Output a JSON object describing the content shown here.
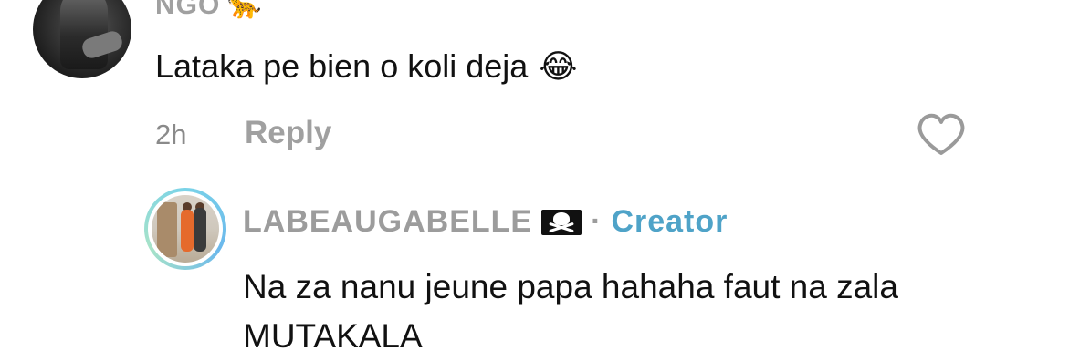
{
  "comment": {
    "username": "NGO",
    "username_emoji": "🐆",
    "text": "Lataka pe bien o koli deja",
    "text_emoji": "😂",
    "time": "2h",
    "reply_label": "Reply",
    "like_icon": "heart-outline-icon"
  },
  "reply": {
    "username": "LABEAUGABELLE",
    "flag_icon": "pirate-flag-icon",
    "separator": "·",
    "badge": "Creator",
    "text": "Na za nanu jeune papa hahaha faut na zala MUTAKALA"
  },
  "colors": {
    "creator_badge": "#4fa3c8",
    "username": "#9c9c9c",
    "ring_gradient": "#7ad3e8"
  }
}
